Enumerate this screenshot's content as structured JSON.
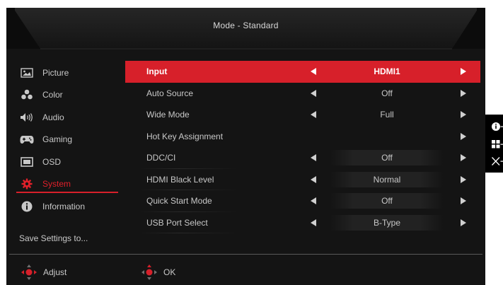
{
  "title": "Mode - Standard",
  "sidebar": {
    "items": [
      {
        "label": "Picture",
        "icon": "picture-icon",
        "active": false
      },
      {
        "label": "Color",
        "icon": "color-palette-icon",
        "active": false
      },
      {
        "label": "Audio",
        "icon": "speaker-icon",
        "active": false
      },
      {
        "label": "Gaming",
        "icon": "gamepad-icon",
        "active": false
      },
      {
        "label": "OSD",
        "icon": "osd-icon",
        "active": false
      },
      {
        "label": "System",
        "icon": "gear-icon",
        "active": true
      },
      {
        "label": "Information",
        "icon": "info-icon",
        "active": false
      }
    ],
    "save_label": "Save Settings to..."
  },
  "menu": {
    "rows": [
      {
        "label": "Input",
        "value": "HDMI1",
        "left_arrow": true,
        "right_arrow": true,
        "selected": true
      },
      {
        "label": "Auto Source",
        "value": "Off",
        "left_arrow": true,
        "right_arrow": true,
        "selected": false
      },
      {
        "label": "Wide Mode",
        "value": "Full",
        "left_arrow": true,
        "right_arrow": true,
        "selected": false
      },
      {
        "label": "Hot Key Assignment",
        "value": "",
        "left_arrow": false,
        "right_arrow": true,
        "selected": false
      },
      {
        "label": "DDC/CI",
        "value": "Off",
        "left_arrow": true,
        "right_arrow": true,
        "selected": false
      },
      {
        "label": "HDMI Black Level",
        "value": "Normal",
        "left_arrow": true,
        "right_arrow": true,
        "selected": false
      },
      {
        "label": "Quick Start Mode",
        "value": "Off",
        "left_arrow": true,
        "right_arrow": true,
        "selected": false
      },
      {
        "label": "USB Port Select",
        "value": "B-Type",
        "left_arrow": true,
        "right_arrow": true,
        "selected": false
      }
    ]
  },
  "footer": {
    "adjust_label": "Adjust",
    "ok_label": "OK"
  },
  "colors": {
    "accent": "#d7202a",
    "background": "#141414",
    "text": "#c8c8c8"
  },
  "side_panel": {
    "icons": [
      "info-icon",
      "grid-icon",
      "close-icon"
    ]
  }
}
